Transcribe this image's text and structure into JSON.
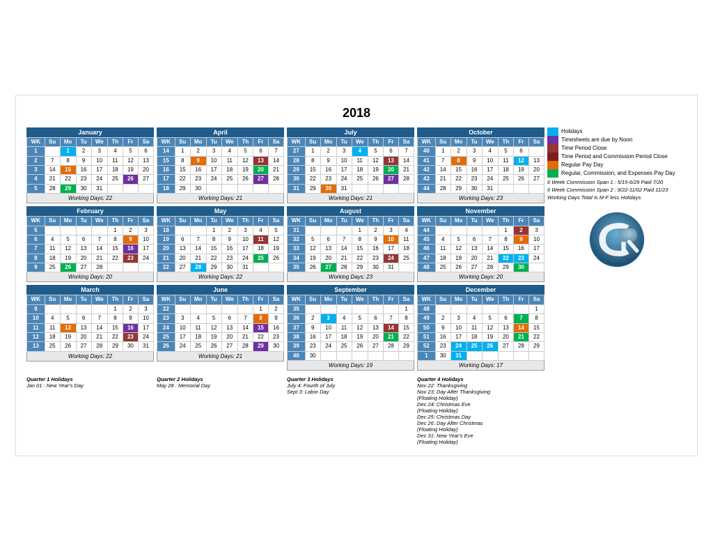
{
  "title": "2018",
  "legend": {
    "items": [
      {
        "color": "#00b0f0",
        "label": "Holidays"
      },
      {
        "color": "#7030a0",
        "label": "Timesheets are due by Noon"
      },
      {
        "color": "#943634",
        "label": "Time Period Close"
      },
      {
        "color": "#7f1d1d",
        "label": "Time Period and Commission Period Close"
      },
      {
        "color": "#e36c09",
        "label": "Regular Pay Day"
      },
      {
        "color": "#00b050",
        "label": "Regular, Commission, and Expenses Pay Day"
      }
    ],
    "notes": [
      "6 Week Commission Span 1 : 5/15-6/29 Paid 7/20",
      "6 Week Commission Span 2 : 9/22-11/02 Paid 11/23",
      "Working Days Total Is M-F less Holidays."
    ]
  },
  "quarters": [
    {
      "label": "Quarter 1 Holidays",
      "items": [
        "Jan 01 : New Year's Day"
      ]
    },
    {
      "label": "Quarter 2 Holidays",
      "items": [
        "May 28 : Memorial Day"
      ]
    },
    {
      "label": "Quarter 3 Holidays",
      "items": [
        "July 4: Fourth of July",
        "Sept 3: Labor Day"
      ]
    },
    {
      "label": "Quarter 4 Holidays",
      "items": [
        "Nov 22: Thanksgiving",
        "Nov 23: Day After Thanksgiving",
        "(Floating Holiday)",
        "Dec 24: Christmas Eve",
        "(Floating Holiday)",
        "Dec 25: Christmas Day",
        "Dec 26: Day After Christmas",
        "(Floating Holiday)",
        "Dec 31: New Year's Eve",
        "(Floating Holiday)"
      ]
    }
  ],
  "working_days": {
    "january": "Working Days: 22",
    "february": "Working Days: 20",
    "march": "Working Days: 22",
    "april": "Working Days: 21",
    "may": "Working Days: 22",
    "june": "Working Days: 21",
    "july": "Working Days: 21",
    "august": "Working Days: 23",
    "september": "Working Days: 19",
    "october": "Working Days: 23",
    "november": "Working Days: 20",
    "december": "Working Days: 17"
  }
}
